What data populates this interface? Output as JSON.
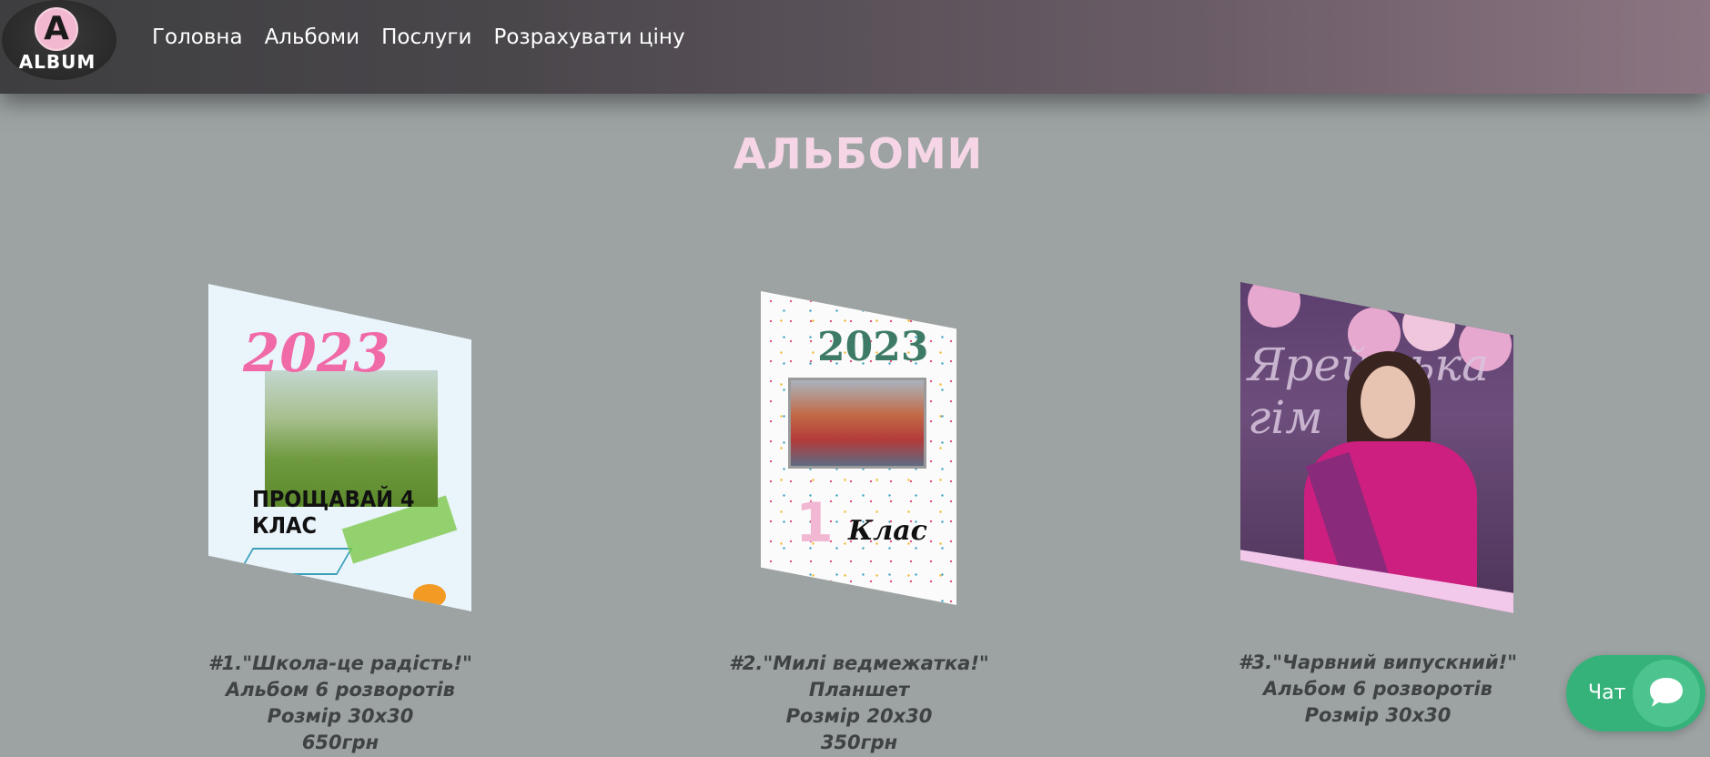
{
  "header": {
    "logo": {
      "letter": "A",
      "word": "ALBUM"
    },
    "nav": [
      {
        "label": "Головна"
      },
      {
        "label": "Альбоми"
      },
      {
        "label": "Послуги"
      },
      {
        "label": "Розрахувати ціну"
      }
    ]
  },
  "main": {
    "title": "АЛЬБОМИ",
    "albums": [
      {
        "image": {
          "year": "2023",
          "slogan": "ПРОЩАВАЙ 4 КЛАС"
        },
        "lines": [
          "#1.\"Школа-це радість!\"",
          "Альбом 6 розворотів",
          "Розмір 30x30",
          "650грн"
        ]
      },
      {
        "image": {
          "year": "2023",
          "grade": "1",
          "grade_word": "Клас"
        },
        "lines": [
          "#2.\"Милі ведмежатка!\"",
          "Планшет",
          "Розмір 20x30",
          "350грн"
        ]
      },
      {
        "image": {
          "script": "Ярей ська гім"
        },
        "lines": [
          "#3.\"Чарвний випускний!\"",
          "Альбом 6 розворотів",
          "Розмір 30x30"
        ]
      }
    ]
  },
  "chat": {
    "label": "Чат",
    "icon": "chat-bubble-icon"
  },
  "colors": {
    "title": "#f6d6e6",
    "chat": "#35b27a",
    "background": "#9ca3a2"
  }
}
